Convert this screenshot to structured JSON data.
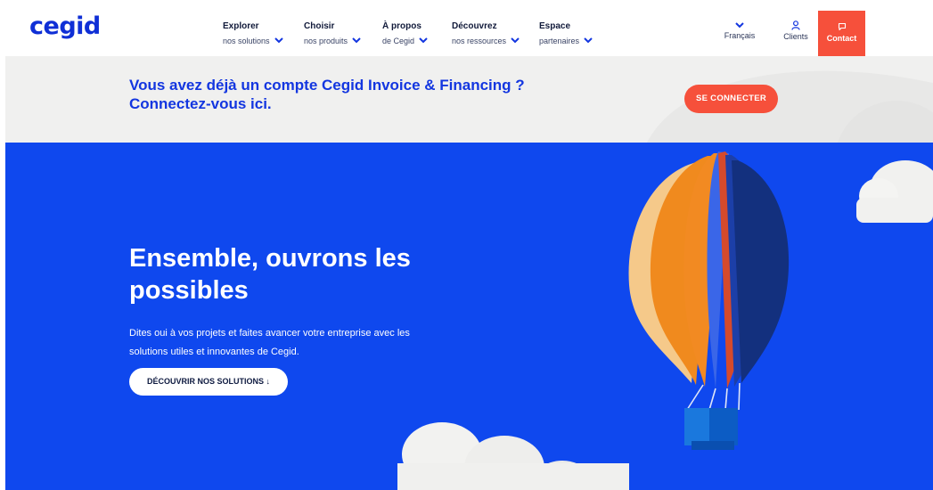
{
  "header": {
    "logo": "cegid",
    "nav": [
      {
        "title": "Explorer",
        "sub": "nos solutions"
      },
      {
        "title": "Choisir",
        "sub": "nos produits"
      },
      {
        "title": "À propos",
        "sub": "de Cegid"
      },
      {
        "title": "Découvrez",
        "sub": "nos ressources"
      },
      {
        "title": "Espace",
        "sub": "partenaires"
      }
    ],
    "language": "Français",
    "clients": "Clients",
    "contact": "Contact"
  },
  "login_band": {
    "title_line1": "Vous avez déjà un compte Cegid Invoice & Financing ?",
    "title_line2": "Connectez-vous ici.",
    "button": "SE CONNECTER"
  },
  "hero": {
    "title": "Ensemble, ouvrons les possibles",
    "text": "Dites oui à vos projets et faites avancer votre entreprise avec les solutions utiles et innovantes de Cegid.",
    "button": "DÉCOUVRIR NOS SOLUTIONS ↓"
  },
  "colors": {
    "brand_blue": "#0f48ee",
    "accent_orange": "#f6503b",
    "logo_blue": "#0f2fd6"
  }
}
